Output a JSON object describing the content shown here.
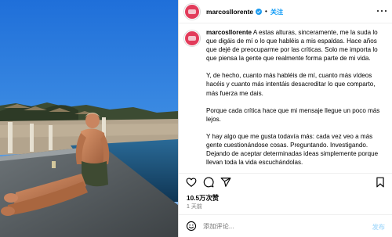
{
  "post": {
    "author": {
      "username": "marcosllorente",
      "verified": true,
      "follow_label": "关注"
    },
    "caption": {
      "username": "marcosllorente",
      "paragraphs": [
        "A estas alturas, sinceramente, me la suda lo que digáis de mí o lo que habléis a mis espaldas. Hace años que dejé de preocuparme por las críticas. Solo me importa lo que piensa la gente que realmente forma parte de mi vida.",
        "Y, de hecho, cuanto más habléis de mí, cuanto más vídeos hacéis y cuanto más intentáis desacreditar lo que comparto, más fuerza me dais.",
        "Porque cada crítica hace que mi mensaje llegue un poco más lejos.",
        "Y hay algo que me gusta todavía más: cada vez veo a más gente cuestionándose cosas. Preguntando. Investigando. Dejando de aceptar determinadas ideas simplemente porque llevan toda la vida escuchándolas."
      ]
    },
    "stats": {
      "likes": "10.5万次赞",
      "time": "1 天前"
    },
    "comment": {
      "placeholder": "添加评论...",
      "post_label": "发布"
    },
    "icons": [
      "more-icon",
      "verified-icon",
      "heart-icon",
      "comment-icon",
      "share-icon",
      "bookmark-icon",
      "emoji-icon"
    ],
    "colors": {
      "accent": "#0095f6",
      "verified": "#1d9bf0",
      "muted": "#737373",
      "post_disabled": "#b2dffc"
    }
  }
}
